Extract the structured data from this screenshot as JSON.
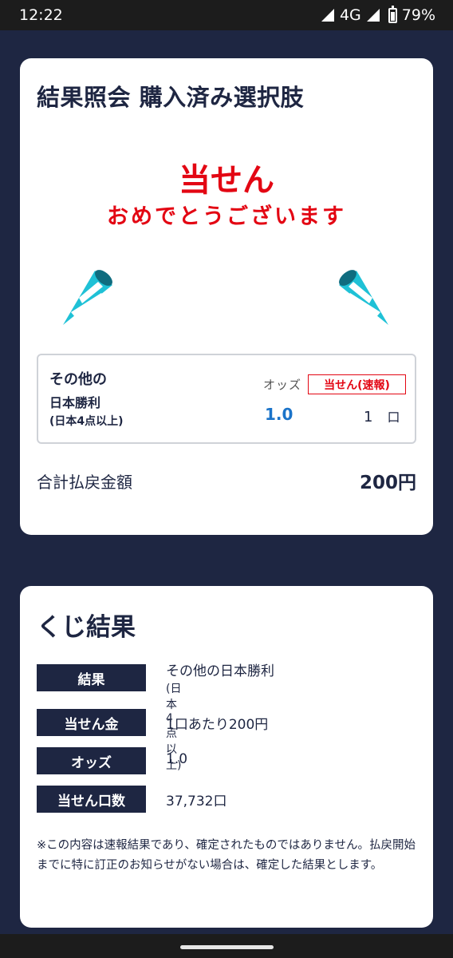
{
  "status_bar": {
    "time": "12:22",
    "network": "4G",
    "battery": "79%"
  },
  "purchase_card": {
    "title": "結果照会 購入済み選択肢",
    "win_title": "当せん",
    "win_message": "おめでとうございます",
    "selection": {
      "name_line1": "その他の",
      "name_line2": "日本勝利",
      "name_line3": "(日本4点以上)",
      "odds_label": "オッズ",
      "odds_value": "1.0",
      "badge": "当せん(速報)",
      "units_count": "1",
      "units_suffix": "口"
    },
    "total_label": "合計払戻金額",
    "total_value": "200円"
  },
  "results_card": {
    "title": "くじ結果",
    "rows": [
      {
        "label": "結果",
        "value": "その他の日本勝利",
        "sub": "(日本4点以上)"
      },
      {
        "label": "当せん金",
        "value": "1口あたり200円"
      },
      {
        "label": "オッズ",
        "value": "1.0"
      },
      {
        "label": "当せん口数",
        "value": "37,732口"
      }
    ],
    "note": "※この内容は速報結果であり、確定されたものではありません。払戻開始までに特に訂正のお知らせがない場合は、確定した結果とします。"
  },
  "icons": {
    "party_left": "party-popper-icon",
    "party_right": "party-popper-icon"
  },
  "colors": {
    "background": "#1e2642",
    "accent_red": "#e30613",
    "odds_blue": "#1a73c9",
    "popper_cyan": "#1fc1d6"
  }
}
